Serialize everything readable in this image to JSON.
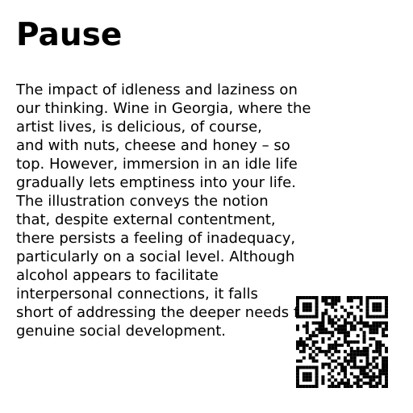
{
  "page": {
    "title": "Pause",
    "body_lines": [
      "The impact of idleness and laziness on",
      "our thinking. Wine in Georgia, where the",
      "artist lives, is delicious, of course,",
      "and with nuts, cheese and honey – so",
      "top. However, immersion in an idle life",
      "gradually lets emptiness into your life.",
      "The illustration conveys the notion",
      "that, despite external contentment,",
      "there persists a feeling of inadequacy,",
      "particularly on a social level. Although",
      "alcohol appears to facilitate",
      "interpersonal connections, it falls",
      "short of addressing the deeper needs for",
      "genuine social development."
    ]
  },
  "colors": {
    "text": "#000000",
    "background": "#ffffff"
  },
  "icons": {
    "qr": "qr-code-icon"
  }
}
